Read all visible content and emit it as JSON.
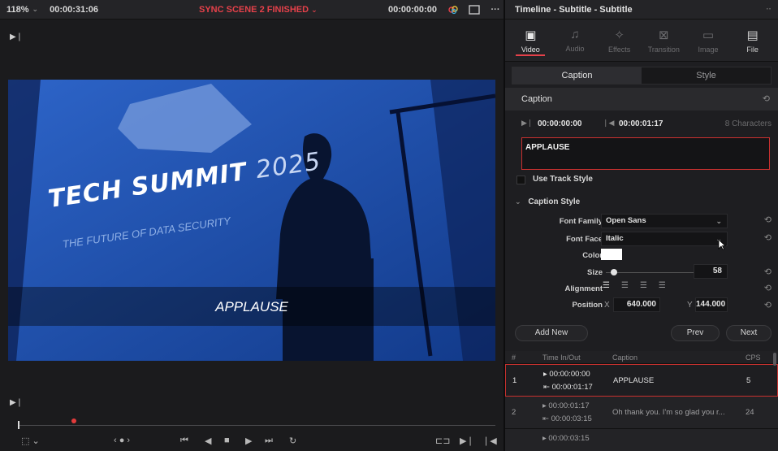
{
  "viewer": {
    "zoom": "118%",
    "timecode": "00:00:31:06",
    "status": "SYNC SCENE 2 FINISHED",
    "timecode_right": "00:00:00:00",
    "caption_overlay": "APPLAUSE",
    "video_text": {
      "title": "TECH SUMMIT",
      "year": "2025",
      "subtitle": "THE FUTURE OF DATA SECURITY"
    }
  },
  "inspector": {
    "title": "Timeline - Subtitle - Subtitle",
    "tabs": [
      {
        "label": "Video",
        "icon": "video-icon",
        "active": true
      },
      {
        "label": "Audio",
        "icon": "audio-icon",
        "active": false
      },
      {
        "label": "Effects",
        "icon": "effects-icon",
        "active": false
      },
      {
        "label": "Transition",
        "icon": "transition-icon",
        "active": false
      },
      {
        "label": "Image",
        "icon": "image-icon",
        "active": false
      },
      {
        "label": "File",
        "icon": "file-icon",
        "active": false
      }
    ],
    "subtabs": [
      {
        "label": "Caption",
        "active": true
      },
      {
        "label": "Style",
        "active": false
      }
    ],
    "caption_section": {
      "heading": "Caption",
      "time_in": "00:00:00:00",
      "time_out": "00:00:01:17",
      "char_count": "8 Characters",
      "text": "APPLAUSE",
      "use_track_style": "Use Track Style"
    },
    "caption_style": {
      "heading": "Caption Style",
      "font_family_label": "Font Family",
      "font_family": "Open Sans",
      "font_face_label": "Font Face",
      "font_face": "Italic",
      "color_label": "Color",
      "color": "#ffffff",
      "size_label": "Size",
      "size": "58",
      "alignment_label": "Alignment",
      "position_label": "Position",
      "pos_x_label": "X",
      "pos_x": "640.000",
      "pos_y_label": "Y",
      "pos_y": "144.000"
    },
    "buttons": {
      "add_new": "Add New",
      "prev": "Prev",
      "next": "Next"
    },
    "table": {
      "headers": {
        "num": "#",
        "time": "Time In/Out",
        "caption": "Caption",
        "cps": "CPS"
      },
      "rows": [
        {
          "num": "1",
          "in": "00:00:00:00",
          "out": "00:00:01:17",
          "caption": "APPLAUSE",
          "cps": "5"
        },
        {
          "num": "2",
          "in": "00:00:01:17",
          "out": "00:00:03:15",
          "caption": "Oh thank you. I'm so glad you r...",
          "cps": "24"
        },
        {
          "num": "",
          "in": "00:00:03:15",
          "out": "",
          "caption": "",
          "cps": ""
        }
      ]
    }
  },
  "colors": {
    "accent_red": "#e5414a",
    "selection_border": "#c9312f"
  }
}
